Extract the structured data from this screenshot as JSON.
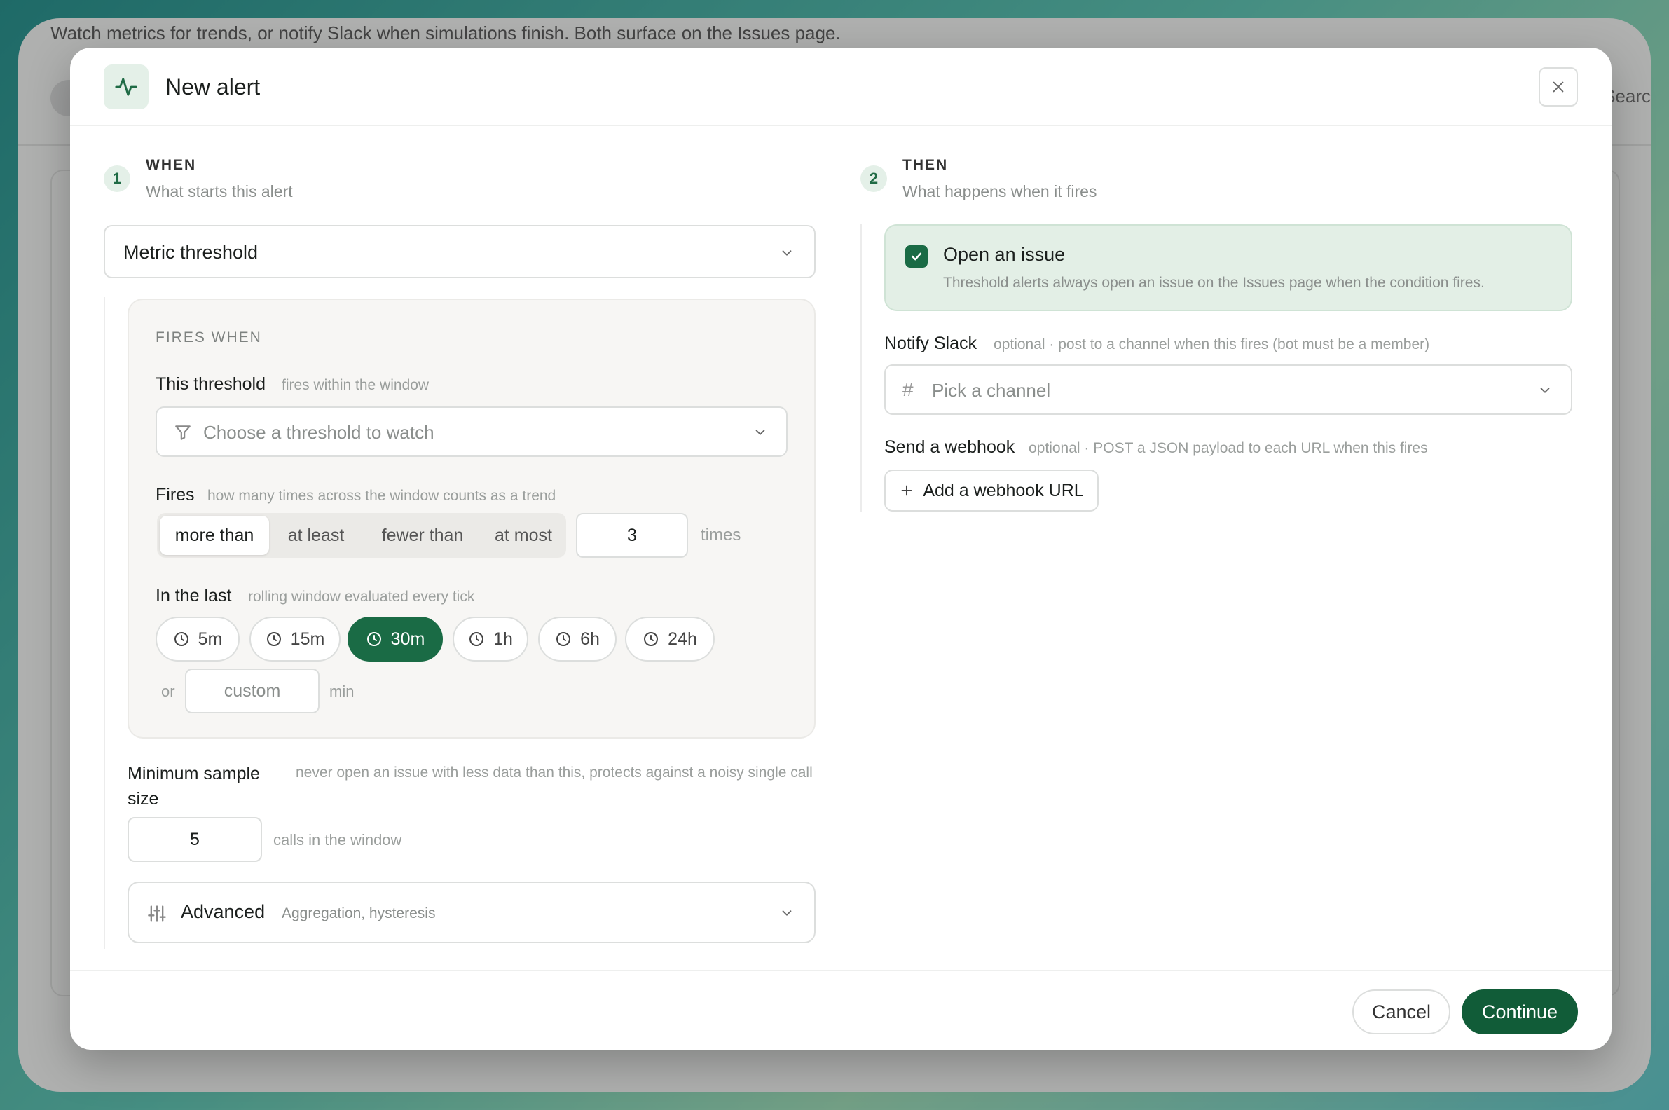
{
  "background": {
    "subtitle": "Watch metrics for trends, or notify Slack when simulations finish. Both surface on the Issues page.",
    "search_hint": "Searc"
  },
  "modal": {
    "title": "New alert",
    "header_icon": "activity-pulse-icon",
    "close_icon": "close-icon"
  },
  "when": {
    "step": "1",
    "label": "WHEN",
    "description": "What starts this alert",
    "trigger_type": "Metric threshold",
    "panel_title": "FIRES WHEN",
    "threshold": {
      "label": "This threshold",
      "hint": "fires within the window",
      "placeholder": "Choose a threshold to watch",
      "icon": "filter-icon"
    },
    "fires": {
      "label": "Fires",
      "hint": "how many times across the window counts as a trend",
      "options": [
        "more than",
        "at least",
        "fewer than",
        "at most"
      ],
      "selected": "more than",
      "count": "3",
      "unit": "times"
    },
    "window": {
      "label": "In the last",
      "hint": "rolling window evaluated every tick",
      "options": [
        "5m",
        "15m",
        "30m",
        "1h",
        "6h",
        "24h"
      ],
      "selected": "30m",
      "or_label": "or",
      "custom_placeholder": "custom",
      "custom_unit": "min"
    },
    "min_sample": {
      "label": "Minimum sample size",
      "hint": "never open an issue with less data than this, protects against a noisy single call",
      "value": "5",
      "unit": "calls in the window"
    },
    "advanced": {
      "label": "Advanced",
      "hint": "Aggregation, hysteresis",
      "icon": "sliders-icon"
    }
  },
  "then": {
    "step": "2",
    "label": "THEN",
    "description": "What happens when it fires",
    "open_issue": {
      "label": "Open an issue",
      "description": "Threshold alerts always open an issue on the Issues page when the condition fires.",
      "checked": true
    },
    "slack": {
      "label": "Notify Slack",
      "hint": "optional · post to a channel when this fires (bot must be a member)",
      "placeholder": "Pick a channel"
    },
    "webhook": {
      "label": "Send a webhook",
      "hint": "optional · POST a JSON payload to each URL when this fires",
      "button": "Add a webhook URL"
    }
  },
  "footer": {
    "cancel": "Cancel",
    "continue": "Continue"
  },
  "colors": {
    "accent": "#1a6b45",
    "accent_dark": "#115c38",
    "accent_soft": "#e3efe6"
  }
}
